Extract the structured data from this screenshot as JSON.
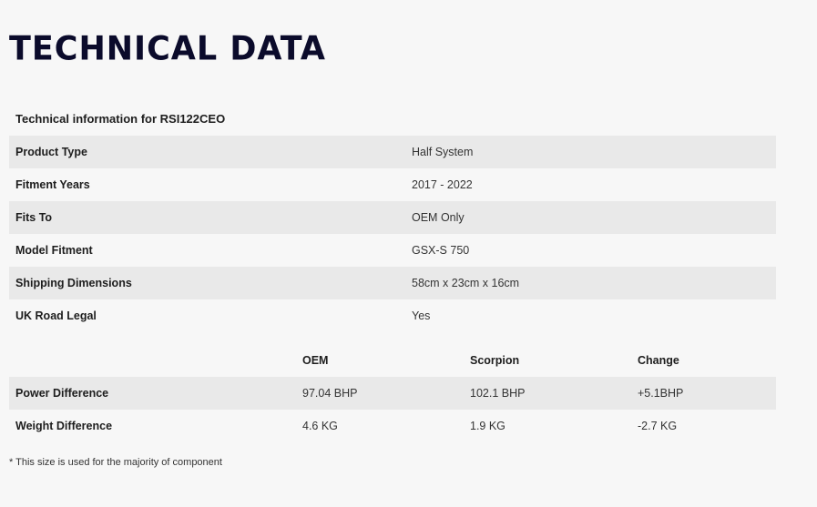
{
  "page": {
    "title": "TECHNICAL DATA"
  },
  "technical": {
    "caption": "Technical information for RSI122CEO",
    "rows": [
      {
        "label": "Product Type",
        "value": "Half System"
      },
      {
        "label": "Fitment Years",
        "value": "2017 - 2022"
      },
      {
        "label": "Fits To",
        "value": "OEM Only"
      },
      {
        "label": "Model Fitment",
        "value": "GSX-S 750"
      },
      {
        "label": "Shipping Dimensions",
        "value": "58cm x 23cm x 16cm"
      },
      {
        "label": "UK Road Legal",
        "value": "Yes"
      }
    ]
  },
  "performance": {
    "headers": {
      "label": "",
      "oem": "OEM",
      "scorpion": "Scorpion",
      "change": "Change"
    },
    "rows": [
      {
        "label": "Power Difference",
        "oem": "97.04 BHP",
        "scorpion": "102.1 BHP",
        "change": "+5.1BHP"
      },
      {
        "label": "Weight Difference",
        "oem": "4.6 KG",
        "scorpion": "1.9 KG",
        "change": "-2.7 KG"
      }
    ]
  },
  "footnote": "* This size is used for the majority of component"
}
